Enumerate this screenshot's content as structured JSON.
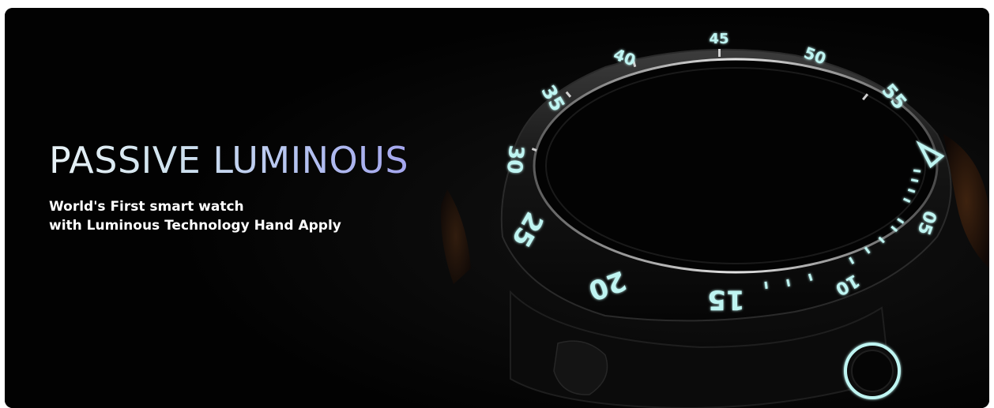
{
  "banner": {
    "headline": "PASSIVE LUMINOUS",
    "subline": {
      "line1": "World's First smart watch",
      "line2": "with Luminous Technology Hand Apply"
    }
  },
  "watch": {
    "bezel_numbers": [
      "15",
      "20",
      "25",
      "30",
      "35",
      "40",
      "45",
      "50",
      "55"
    ],
    "inner_markers": [
      "10",
      "05"
    ],
    "lume_color": "#bff5f2",
    "lume_shadow_color": "#5fd8d2",
    "background_color": "#020202",
    "strap_color": "#3a1e0c"
  },
  "colors": {
    "headline_gradient_start": "#e8f2f6",
    "headline_gradient_end": "#a4a6ee",
    "subline_text": "#ffffff"
  }
}
